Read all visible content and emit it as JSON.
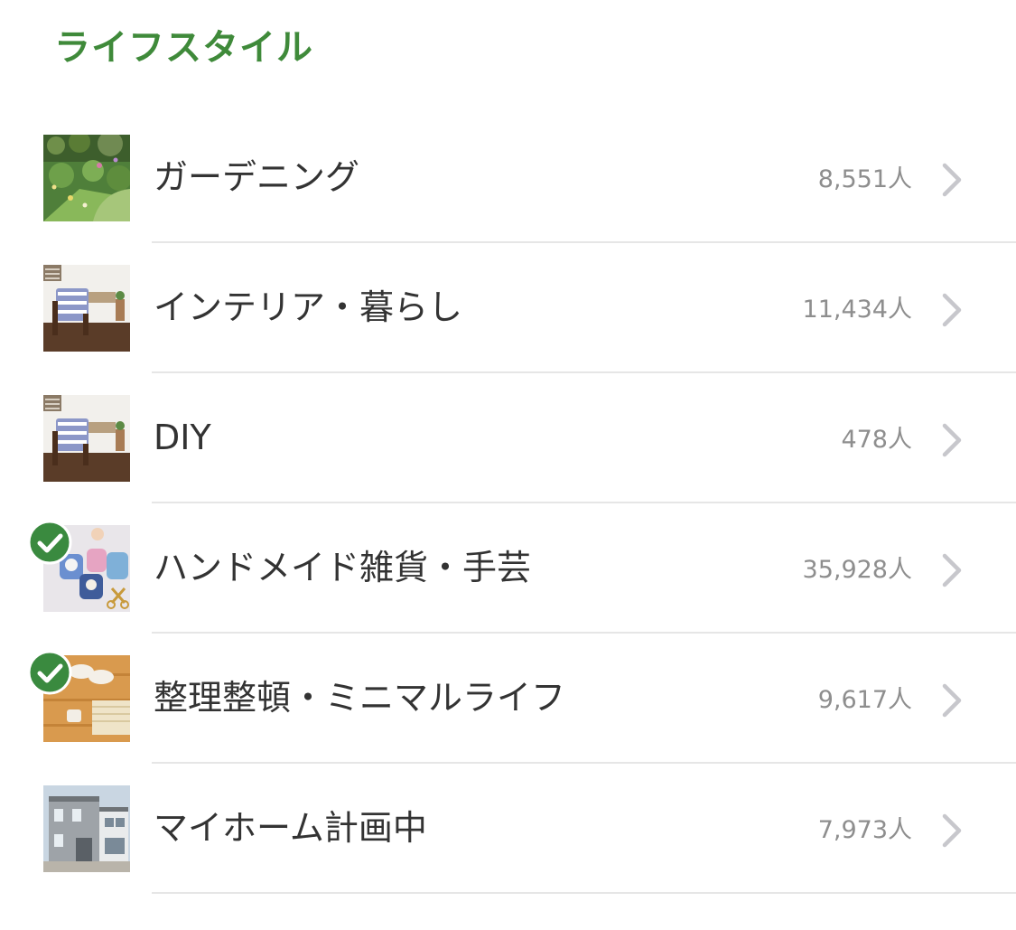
{
  "section": {
    "title": "ライフスタイル"
  },
  "items": [
    {
      "label": "ガーデニング",
      "count": "8,551人",
      "checked": false,
      "thumb": "garden-photo"
    },
    {
      "label": "インテリア・暮らし",
      "count": "11,434人",
      "checked": false,
      "thumb": "interior-chair-photo"
    },
    {
      "label": "DIY",
      "count": "478人",
      "checked": false,
      "thumb": "interior-chair-photo"
    },
    {
      "label": "ハンドメイド雑貨・手芸",
      "count": "35,928人",
      "checked": true,
      "thumb": "handmade-crafts-photo"
    },
    {
      "label": "整理整頓・ミニマルライフ",
      "count": "9,617人",
      "checked": true,
      "thumb": "slippers-floor-photo"
    },
    {
      "label": "マイホーム計画中",
      "count": "7,973人",
      "checked": false,
      "thumb": "house-photo"
    }
  ],
  "colors": {
    "accent": "#3f8a3a",
    "check_badge": "#3a8a3f",
    "label": "#333333",
    "count": "#8e8e8e",
    "chevron": "#c7c7cc",
    "divider": "#e6e6e6"
  },
  "icons": {
    "chevron": "chevron-right-icon",
    "check": "check-circle-icon"
  }
}
